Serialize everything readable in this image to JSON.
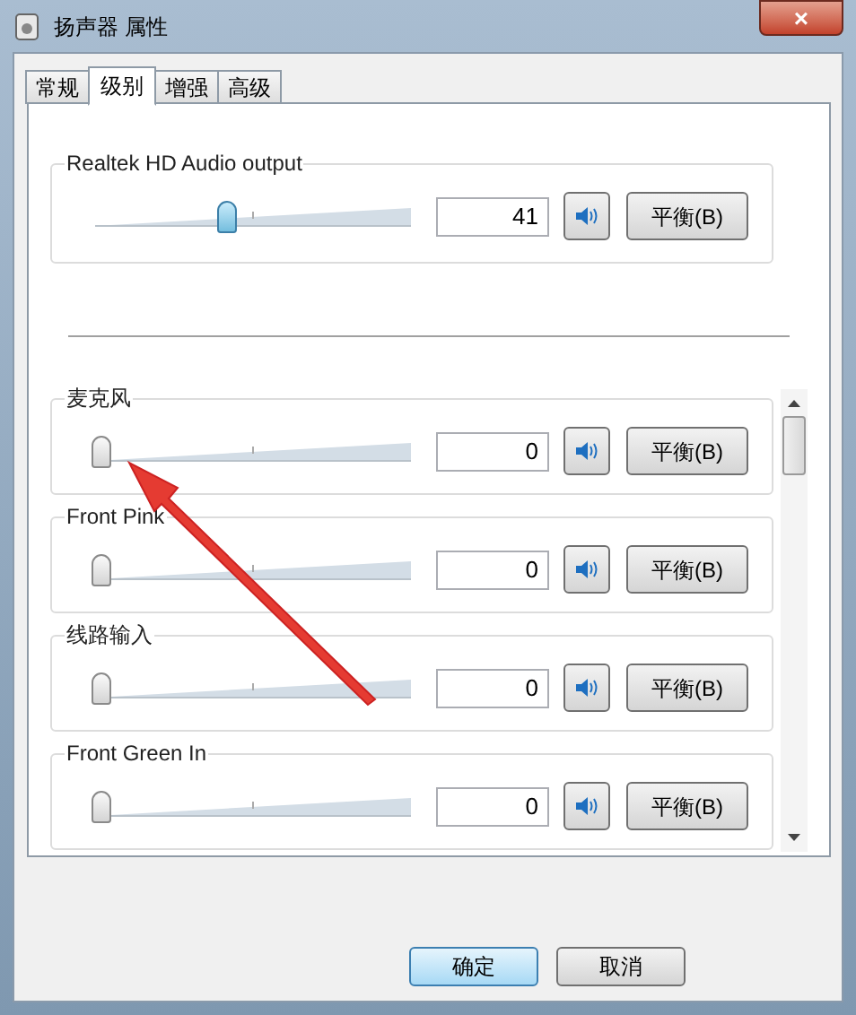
{
  "window": {
    "title": "扬声器 属性",
    "close": "×"
  },
  "tabs": [
    {
      "label": "常规",
      "selected": false
    },
    {
      "label": "级别",
      "selected": true
    },
    {
      "label": "增强",
      "selected": false
    },
    {
      "label": "高级",
      "selected": false
    }
  ],
  "master": {
    "name": "Realtek HD Audio output",
    "level": 0.41,
    "value": "41",
    "balance": "平衡(B)"
  },
  "devices": [
    {
      "name": "麦克风",
      "level": 0,
      "value": "0",
      "balance": "平衡(B)"
    },
    {
      "name": "Front Pink",
      "level": 0,
      "value": "0",
      "balance": "平衡(B)"
    },
    {
      "name": "线路输入",
      "level": 0,
      "value": "0",
      "balance": "平衡(B)"
    },
    {
      "name": "Front Green In",
      "level": 0,
      "value": "0",
      "balance": "平衡(B)"
    }
  ],
  "buttons": [
    {
      "label": "确定",
      "selected": true
    },
    {
      "label": "取消",
      "selected": false
    }
  ]
}
